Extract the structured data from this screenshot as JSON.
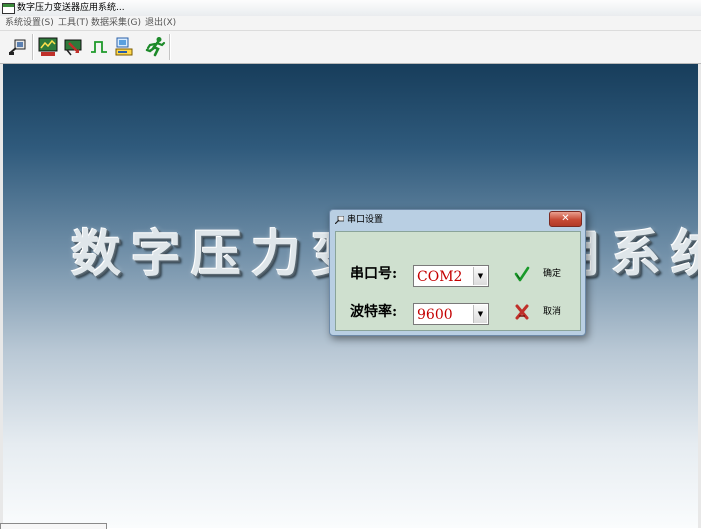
{
  "window": {
    "title": "数字压力变送器应用系统..."
  },
  "menu": {
    "items": [
      {
        "label": "系统设置(S)"
      },
      {
        "label": "工具(T)"
      },
      {
        "label": "数据采集(G)"
      },
      {
        "label": "退出(X)"
      }
    ]
  },
  "toolbar": {
    "buttons": [
      {
        "icon": "serial-port-icon"
      },
      {
        "icon": "chart-monitor-icon"
      },
      {
        "icon": "chart-arrow-icon"
      },
      {
        "icon": "pulse-wave-icon"
      },
      {
        "icon": "computer-device-icon"
      },
      {
        "icon": "exit-running-man-icon"
      }
    ]
  },
  "background": {
    "banner_text": "数字压力变送器应用系统"
  },
  "dialog": {
    "title": "串口设置",
    "close_symbol": "✕",
    "port_label": "串口号:",
    "port_value": "COM2",
    "baud_label": "波特率:",
    "baud_value": "9600",
    "ok_label": "确定",
    "cancel_label": "取消"
  },
  "colors": {
    "combo_text": "#c40000",
    "dialog_frame": "#b9cfe3",
    "dialog_body": "#cfe0cf",
    "close_button": "#c74a35"
  }
}
